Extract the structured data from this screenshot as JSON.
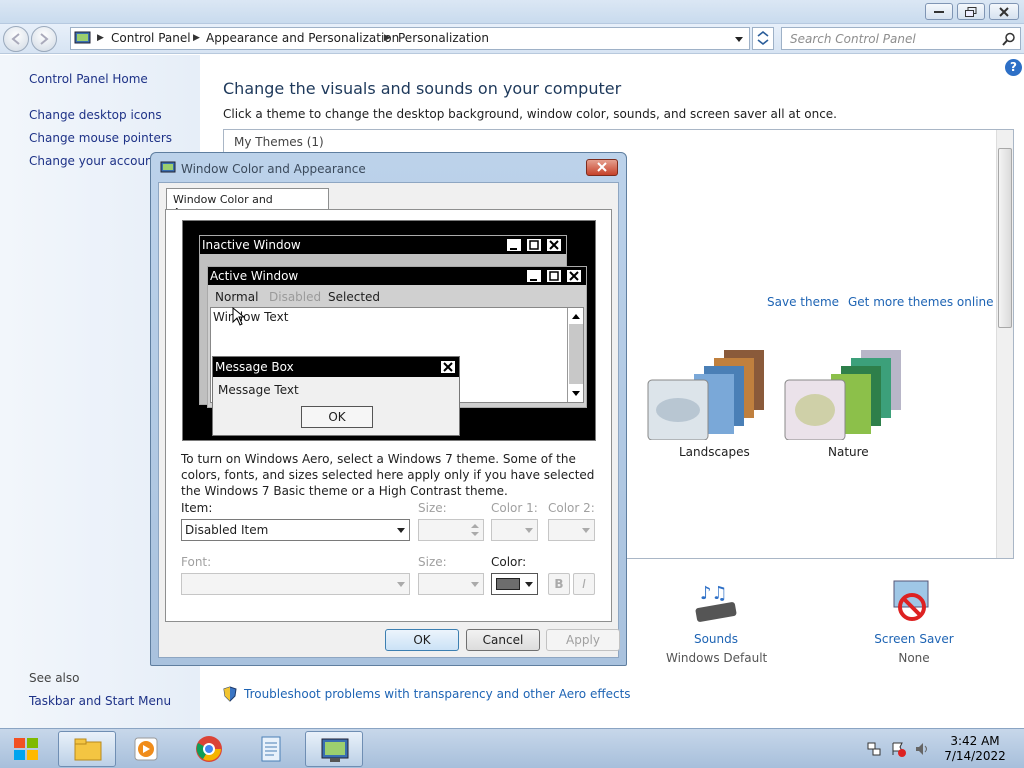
{
  "address": {
    "crumbs": [
      "Control Panel",
      "Appearance and Personalization",
      "Personalization"
    ],
    "search_placeholder": "Search Control Panel"
  },
  "left_pane": {
    "home": "Control Panel Home",
    "links": [
      "Change desktop icons",
      "Change mouse pointers",
      "Change your account picture"
    ],
    "see_also": "See also",
    "see_also_links": [
      "Taskbar and Start Menu"
    ]
  },
  "content": {
    "title": "Change the visuals and sounds on your computer",
    "subtitle": "Click a theme to change the desktop background, window color, sounds, and screen saver all at once.",
    "my_themes": "My Themes (1)",
    "save_theme": "Save theme",
    "get_more": "Get more themes online",
    "themes": [
      "Landscapes",
      "Nature"
    ],
    "sounds_label": "Sounds",
    "sounds_value": "Windows Default",
    "screensaver_label": "Screen Saver",
    "screensaver_value": "None",
    "troubleshoot": "Troubleshoot problems with transparency and other Aero effects"
  },
  "dialog": {
    "title": "Window Color and Appearance",
    "tab": "Window Color and Appearance",
    "preview": {
      "inactive": "Inactive Window",
      "active": "Active Window",
      "menu_normal": "Normal",
      "menu_disabled": "Disabled",
      "menu_selected": "Selected",
      "window_text": "Window Text",
      "msgbox_title": "Message Box",
      "msgbox_text": "Message Text",
      "msgbox_ok": "OK"
    },
    "info": "To turn on Windows Aero, select a Windows 7 theme.  Some of the colors, fonts, and sizes selected here apply only if you have selected the Windows 7 Basic theme or a High Contrast theme.",
    "item_label": "Item:",
    "item_value": "Disabled Item",
    "size_label": "Size:",
    "color1_label": "Color 1:",
    "color2_label": "Color 2:",
    "font_label": "Font:",
    "size2_label": "Size:",
    "color_label": "Color:",
    "bold": "B",
    "italic": "I",
    "ok": "OK",
    "cancel": "Cancel",
    "apply": "Apply"
  },
  "taskbar": {
    "time": "3:42 AM",
    "date": "7/14/2022"
  },
  "colors": {
    "link": "#1e64b4",
    "left_link": "#1e3287",
    "swatch": "#6d6d6d"
  }
}
